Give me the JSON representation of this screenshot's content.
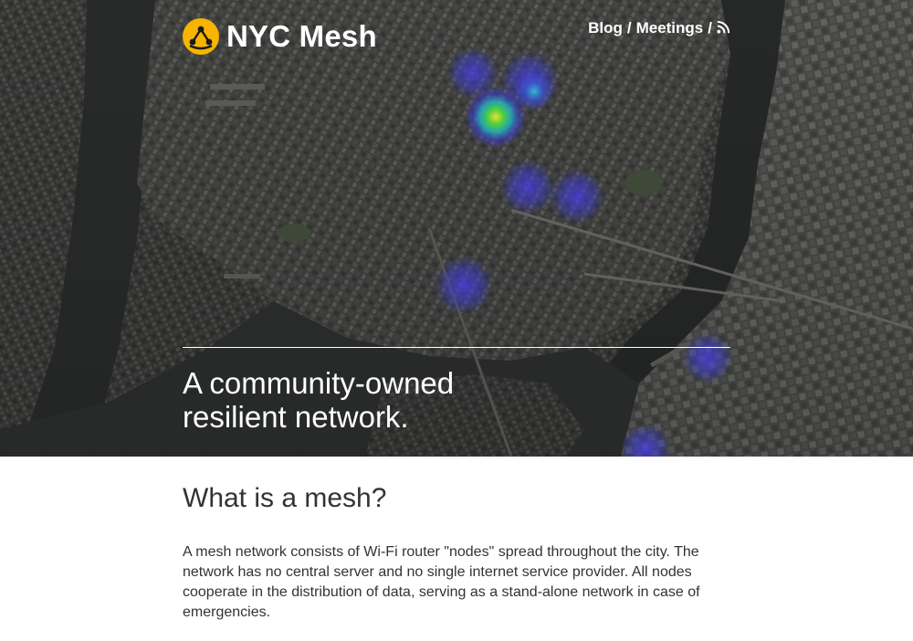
{
  "header": {
    "brand": "NYC Mesh",
    "logo_icon": "mesh-logo-icon",
    "nav": {
      "blog": "Blog",
      "separator": "/",
      "meetings": "Meetings",
      "rss_icon": "rss-icon"
    }
  },
  "hero": {
    "tagline_line1": "A community-owned",
    "tagline_line2": "resilient network.",
    "background": "satellite-map-with-node-heatmap"
  },
  "section": {
    "heading": "What is a mesh?",
    "body": "A mesh network consists of Wi-Fi router \"nodes\" spread throughout the city. The network has no central server and no single internet service provider. All nodes cooperate in the distribution of data, serving as a stand-alone network in case of emergencies."
  },
  "colors": {
    "brand_yellow": "#f7b500",
    "text_dark": "#333333",
    "heat_green": "#3bd83a",
    "heat_blue": "#3a3cd8"
  }
}
